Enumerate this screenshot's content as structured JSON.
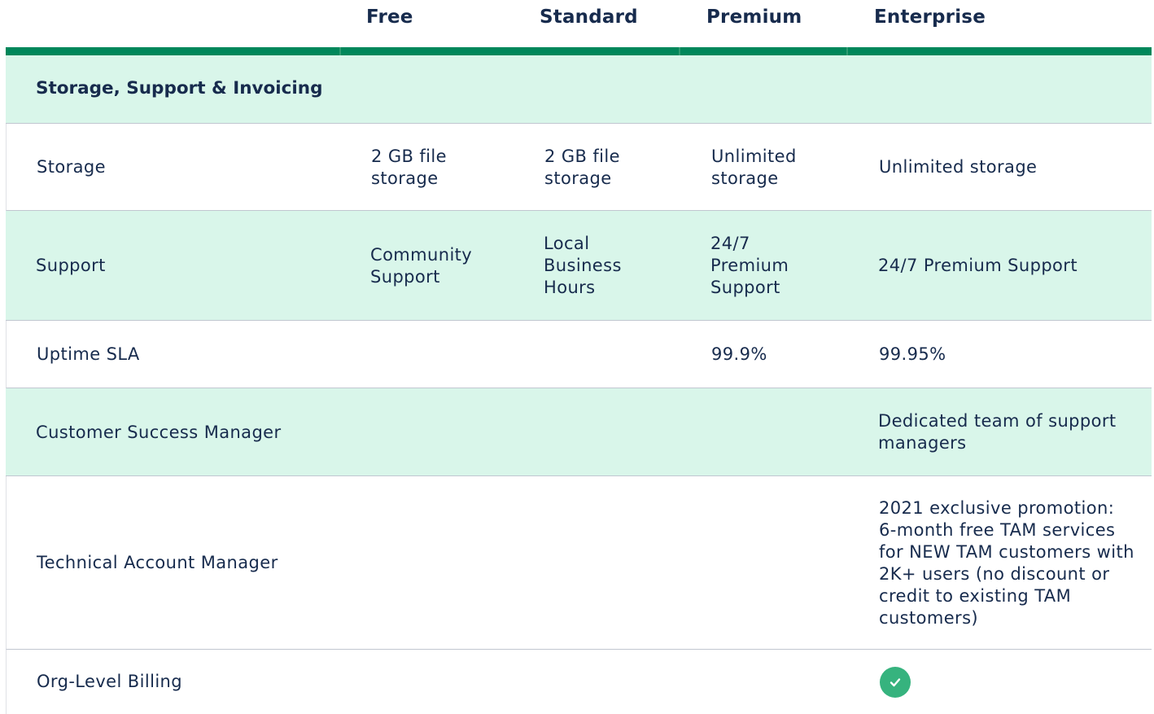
{
  "header": {
    "plans": [
      "Free",
      "Standard",
      "Premium",
      "Enterprise"
    ]
  },
  "section": {
    "title": "Storage, Support & Invoicing"
  },
  "rows": {
    "storage": {
      "label": "Storage",
      "free": "2 GB file storage",
      "standard": "2 GB file storage",
      "premium": "Unlimited storage",
      "enterprise": "Unlimited storage"
    },
    "support": {
      "label": "Support",
      "free": "Community Support",
      "standard": "Local Business Hours",
      "premium": "24/7 Premium Support",
      "enterprise": "24/7 Premium Support"
    },
    "uptime": {
      "label": "Uptime SLA",
      "premium": "99.9%",
      "enterprise": "99.95%"
    },
    "csm": {
      "label": "Customer Success Manager",
      "enterprise": "Dedicated team of support managers"
    },
    "tam": {
      "label": "Technical Account Manager",
      "enterprise": "2021 exclusive promotion: 6-month free TAM services for NEW TAM customers with 2K+ users (no discount or credit to existing TAM customers)"
    },
    "billing": {
      "label": "Org-Level Billing",
      "enterprise_icon": "check-circle-icon"
    }
  },
  "colors": {
    "accent": "#00875a",
    "row_tint": "#d9f6ea",
    "check": "#36b37e",
    "text": "#172b4d"
  }
}
